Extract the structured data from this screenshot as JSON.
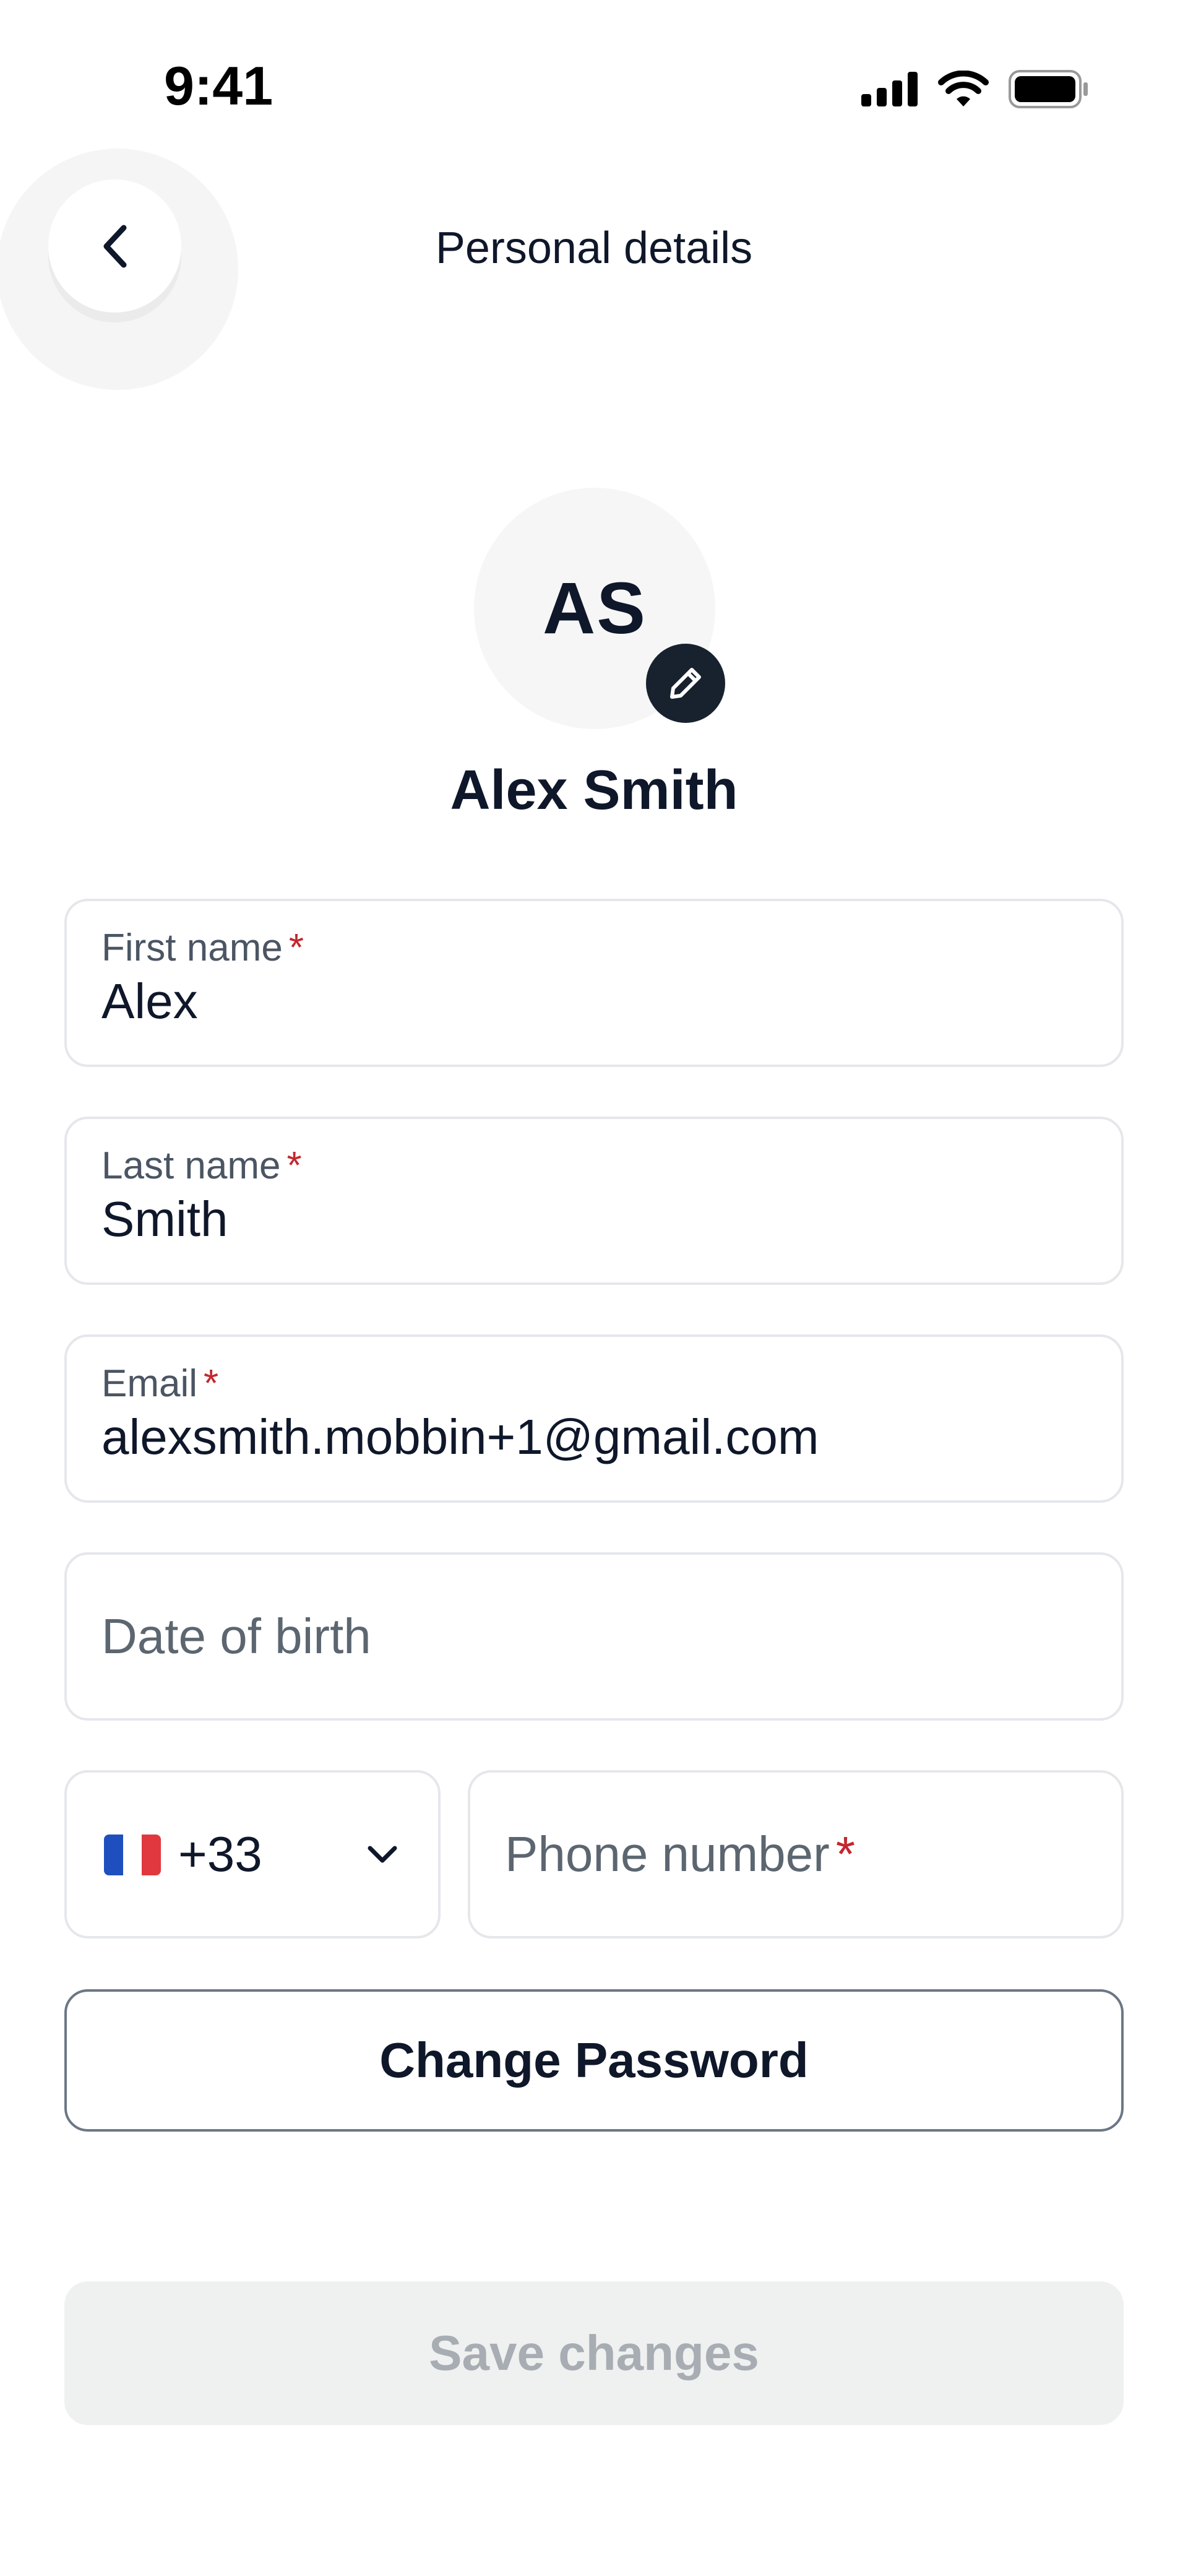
{
  "status_bar": {
    "time": "9:41",
    "icons": [
      "signal-icon",
      "wifi-icon",
      "battery-icon"
    ]
  },
  "header": {
    "back_icon": "chevron-left-icon",
    "title": "Personal details"
  },
  "profile": {
    "initials": "AS",
    "edit_icon": "pencil-icon",
    "name": "Alex Smith"
  },
  "form": {
    "first_name": {
      "label": "First name",
      "required_mark": "*",
      "value": "Alex"
    },
    "last_name": {
      "label": "Last name",
      "required_mark": "*",
      "value": "Smith"
    },
    "email": {
      "label": "Email",
      "required_mark": "*",
      "value": "alexsmith.mobbin+1@gmail.com"
    },
    "date_of_birth": {
      "placeholder": "Date of birth"
    },
    "country_code": {
      "flag_icon": "france-flag-icon",
      "value": "+33",
      "dropdown_icon": "chevron-down-icon"
    },
    "phone_number": {
      "placeholder": "Phone number",
      "required_mark": "*"
    }
  },
  "actions": {
    "change_password_label": "Change Password",
    "save_label": "Save changes"
  },
  "colors": {
    "text_primary": "#0f172a",
    "required": "#c2272d",
    "field_border": "#e5e7eb",
    "save_disabled_bg": "#eff0f0",
    "save_disabled_text": "#a7adb3",
    "edit_badge": "#17222e"
  }
}
